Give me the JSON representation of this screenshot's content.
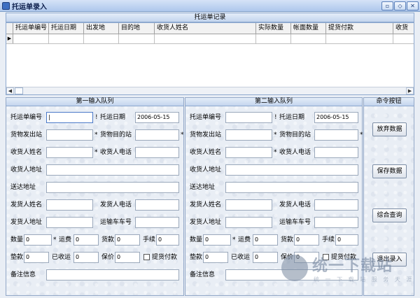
{
  "window": {
    "title": "托运单录入",
    "min": "▫",
    "max": "◇",
    "close": "✕"
  },
  "records": {
    "title": "托运单记录",
    "columns": [
      "托运单编号",
      "托运日期",
      "出发地",
      "目的地",
      "收货人姓名",
      "实际数量",
      "帐面数量",
      "提货付款",
      "收货"
    ],
    "row_marker": "▶"
  },
  "queue1": {
    "title": "第一输入队列",
    "labels": {
      "order_no": "托运单编号",
      "date": "托运日期",
      "from": "货物发出站",
      "to": "货物目的站",
      "recv_name": "收货人姓名",
      "recv_phone": "收货人电话",
      "recv_addr": "收货人地址",
      "deliver_addr": "送达地址",
      "send_name": "发货人姓名",
      "send_phone": "发货人电话",
      "send_addr": "发货人地址",
      "truck": "运输车车号",
      "qty": "数量",
      "freight": "运费",
      "goods_pay": "货款",
      "fee": "手续",
      "advance": "垫款",
      "received": "已收运",
      "insure": "保价",
      "pickup_pay": "提货付款",
      "note": "备注信息"
    },
    "values": {
      "order_no": "|",
      "date": "2006-05-15",
      "qty": "0",
      "freight": "0",
      "goods_pay": "0",
      "fee": "0",
      "advance": "0",
      "received": "0",
      "insure": "0"
    }
  },
  "queue2": {
    "title": "第二输入队列",
    "labels": {
      "order_no": "托运单编号",
      "date": "托运日期",
      "from": "货物发出站",
      "to": "货物目的站",
      "recv_name": "收货人姓名",
      "recv_phone": "收货人电话",
      "recv_addr": "收货人地址",
      "deliver_addr": "送达地址",
      "send_name": "发货人姓名",
      "send_phone": "发货人电话",
      "send_addr": "发货人地址",
      "truck": "运输车车号",
      "qty": "数量",
      "freight": "运费",
      "goods_pay": "货款",
      "fee": "手续",
      "advance": "垫款",
      "received": "已收运",
      "insure": "保价",
      "pickup_pay": "提货付款",
      "note": "备注信息"
    },
    "values": {
      "date": "2006-05-15",
      "qty": "0",
      "freight": "0",
      "goods_pay": "0",
      "fee": "0",
      "advance": "0",
      "received": "0",
      "insure": "0"
    }
  },
  "commands": {
    "title": "命令按钮",
    "discard": "放弃数据",
    "save": "保存数据",
    "query": "综合查询",
    "exit": "退出录入"
  },
  "watermark": {
    "brand": "统一下载站",
    "sub": "统 一 下 载 站 服 务 天 涯"
  },
  "colors": {
    "title_bar": "#aec7ec",
    "panel_bg": "#e9eef5",
    "border": "#8ea9cf"
  }
}
